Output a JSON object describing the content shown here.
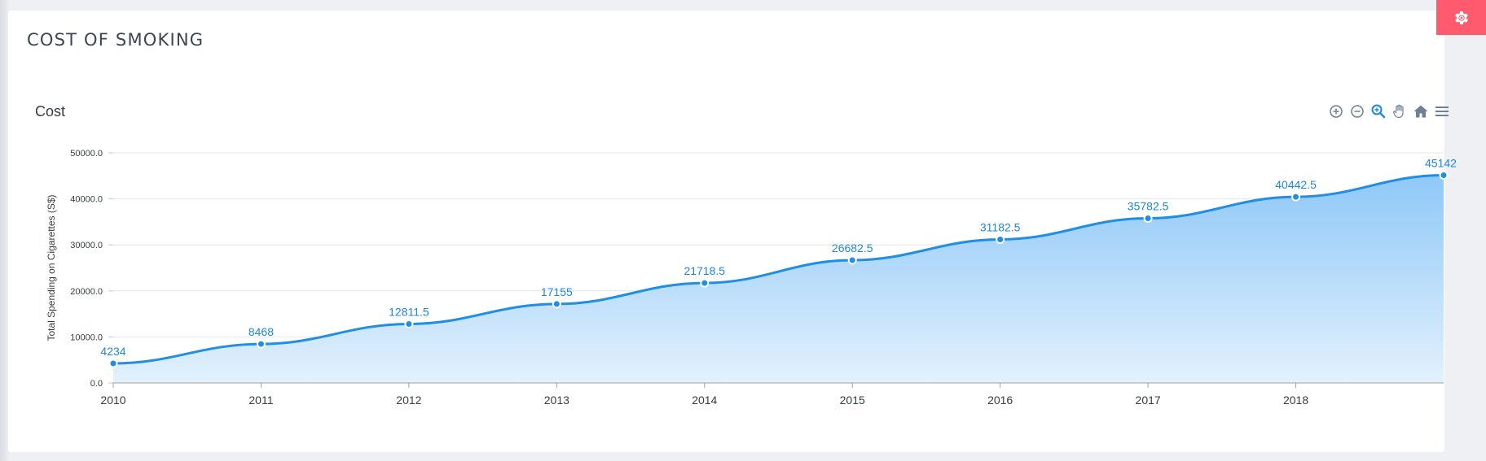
{
  "page": {
    "title": "COST OF SMOKING"
  },
  "toolbar": {
    "icons": [
      "zoom-in-icon",
      "zoom-out-icon",
      "selection-zoom-icon",
      "pan-icon",
      "home-icon",
      "menu-icon"
    ]
  },
  "colors": {
    "accent": "#ff5a6e",
    "series": "#1e8ee6",
    "fill_top": "#8fc8f7",
    "fill_bottom": "#e3f1fd"
  },
  "chart_data": {
    "type": "area",
    "title": "Cost",
    "xlabel": "",
    "ylabel": "Total Spending on Cigarettes (S$)",
    "x": [
      2010,
      2011,
      2012,
      2013,
      2014,
      2015,
      2016,
      2017,
      2018,
      2019
    ],
    "x_tick_labels": [
      "2010",
      "2011",
      "2012",
      "2013",
      "2014",
      "2015",
      "2016",
      "2017",
      "2018"
    ],
    "series": [
      {
        "name": "",
        "values": [
          4234,
          8468,
          12811.5,
          17155,
          21718.5,
          26682.5,
          31182.5,
          35782.5,
          40442.5,
          45142
        ]
      }
    ],
    "data_labels": [
      "4234",
      "8468",
      "12811.5",
      "17155",
      "21718.5",
      "26682.5",
      "31182.5",
      "35782.5",
      "40442.5",
      "45142"
    ],
    "y_tick_labels": [
      "0.0",
      "10000.0",
      "20000.0",
      "30000.0",
      "40000.0",
      "50000.0"
    ],
    "y_ticks": [
      0,
      10000,
      20000,
      30000,
      40000,
      50000
    ],
    "ylim": [
      0,
      50000
    ],
    "xlim": [
      2010,
      2019
    ],
    "grid": true,
    "legend": "none"
  }
}
